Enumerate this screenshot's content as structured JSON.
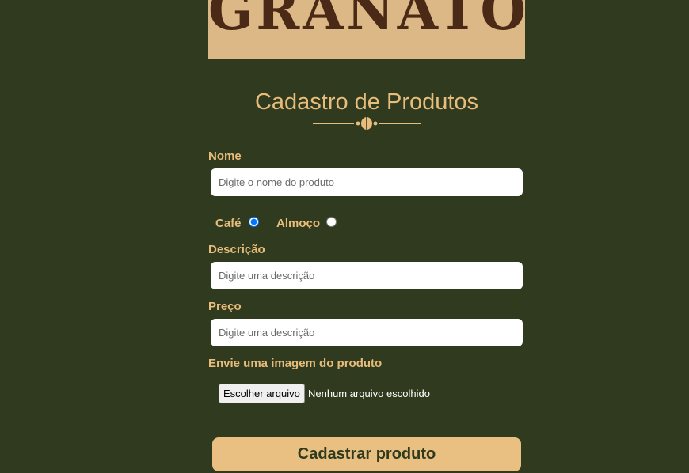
{
  "header": {
    "brand": "GRANATO"
  },
  "form": {
    "title": "Cadastro de Produtos",
    "name_label": "Nome",
    "name_placeholder": "Digite o nome do produto",
    "category": {
      "options": [
        "Café",
        "Almoço"
      ],
      "selected": "Café"
    },
    "description_label": "Descrição",
    "description_placeholder": "Digite uma descrição",
    "price_label": "Preço",
    "price_placeholder": "Digite uma descrição",
    "image_label": "Envie uma imagem do produto",
    "file_button": "Escolher arquivo",
    "file_status": "Nenhum arquivo escolhido",
    "submit_label": "Cadastrar produto"
  },
  "colors": {
    "background": "#2f3a1e",
    "accent": "#e8bd7b",
    "banner": "#dcb887",
    "brand_text": "#4a2a16"
  }
}
